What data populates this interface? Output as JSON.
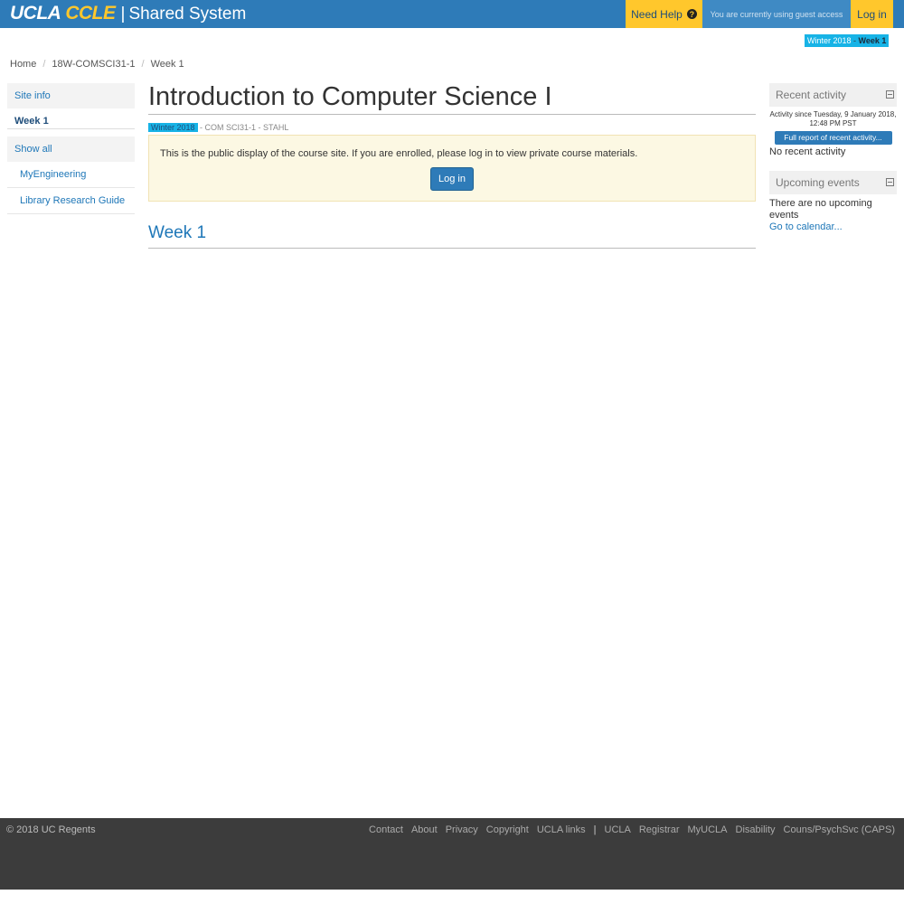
{
  "header": {
    "brand_ucla": "UCLA",
    "brand_ccle": "CCLE",
    "brand_separator": "|",
    "brand_system": "Shared System",
    "help_label": "Need Help",
    "guest_text": "You are currently using guest access",
    "login_label": "Log in"
  },
  "term_badge": {
    "term": "Winter 2018",
    "separator": " - ",
    "week": "Week 1"
  },
  "breadcrumb": [
    "Home",
    "18W-COMSCI31-1",
    "Week 1"
  ],
  "leftnav": {
    "site_info": "Site info",
    "week": "Week 1",
    "show_all": "Show all",
    "links": [
      "MyEngineering",
      "Library Research Guide"
    ]
  },
  "main": {
    "title": "Introduction to Computer Science I",
    "term": "Winter 2018",
    "subtitle_rest": " - COM SCI31-1 - STAHL",
    "notice": "This is the public display of the course site. If you are enrolled, please log in to view private course materials.",
    "login_button": "Log in",
    "section_title": "Week 1"
  },
  "recent_activity": {
    "title": "Recent activity",
    "since": "Activity since Tuesday, 9 January 2018, 12:48 PM PST",
    "report_button": "Full report of recent activity...",
    "none": "No recent activity"
  },
  "upcoming_events": {
    "title": "Upcoming events",
    "none": "There are no upcoming events",
    "calendar_link": "Go to calendar..."
  },
  "footer": {
    "copyright": "© 2018 UC Regents",
    "links": [
      "Contact",
      "About",
      "Privacy",
      "Copyright",
      "UCLA links"
    ],
    "separator": "|",
    "links2": [
      "UCLA",
      "Registrar",
      "MyUCLA",
      "Disability",
      "Couns/PsychSvc (CAPS)"
    ]
  },
  "colors": {
    "header_blue": "#2e7bb8",
    "gold": "#ffc72c",
    "term_cyan": "#17b3e6",
    "link_blue": "#1e77b8",
    "footer_gray": "#3c3c3c"
  }
}
